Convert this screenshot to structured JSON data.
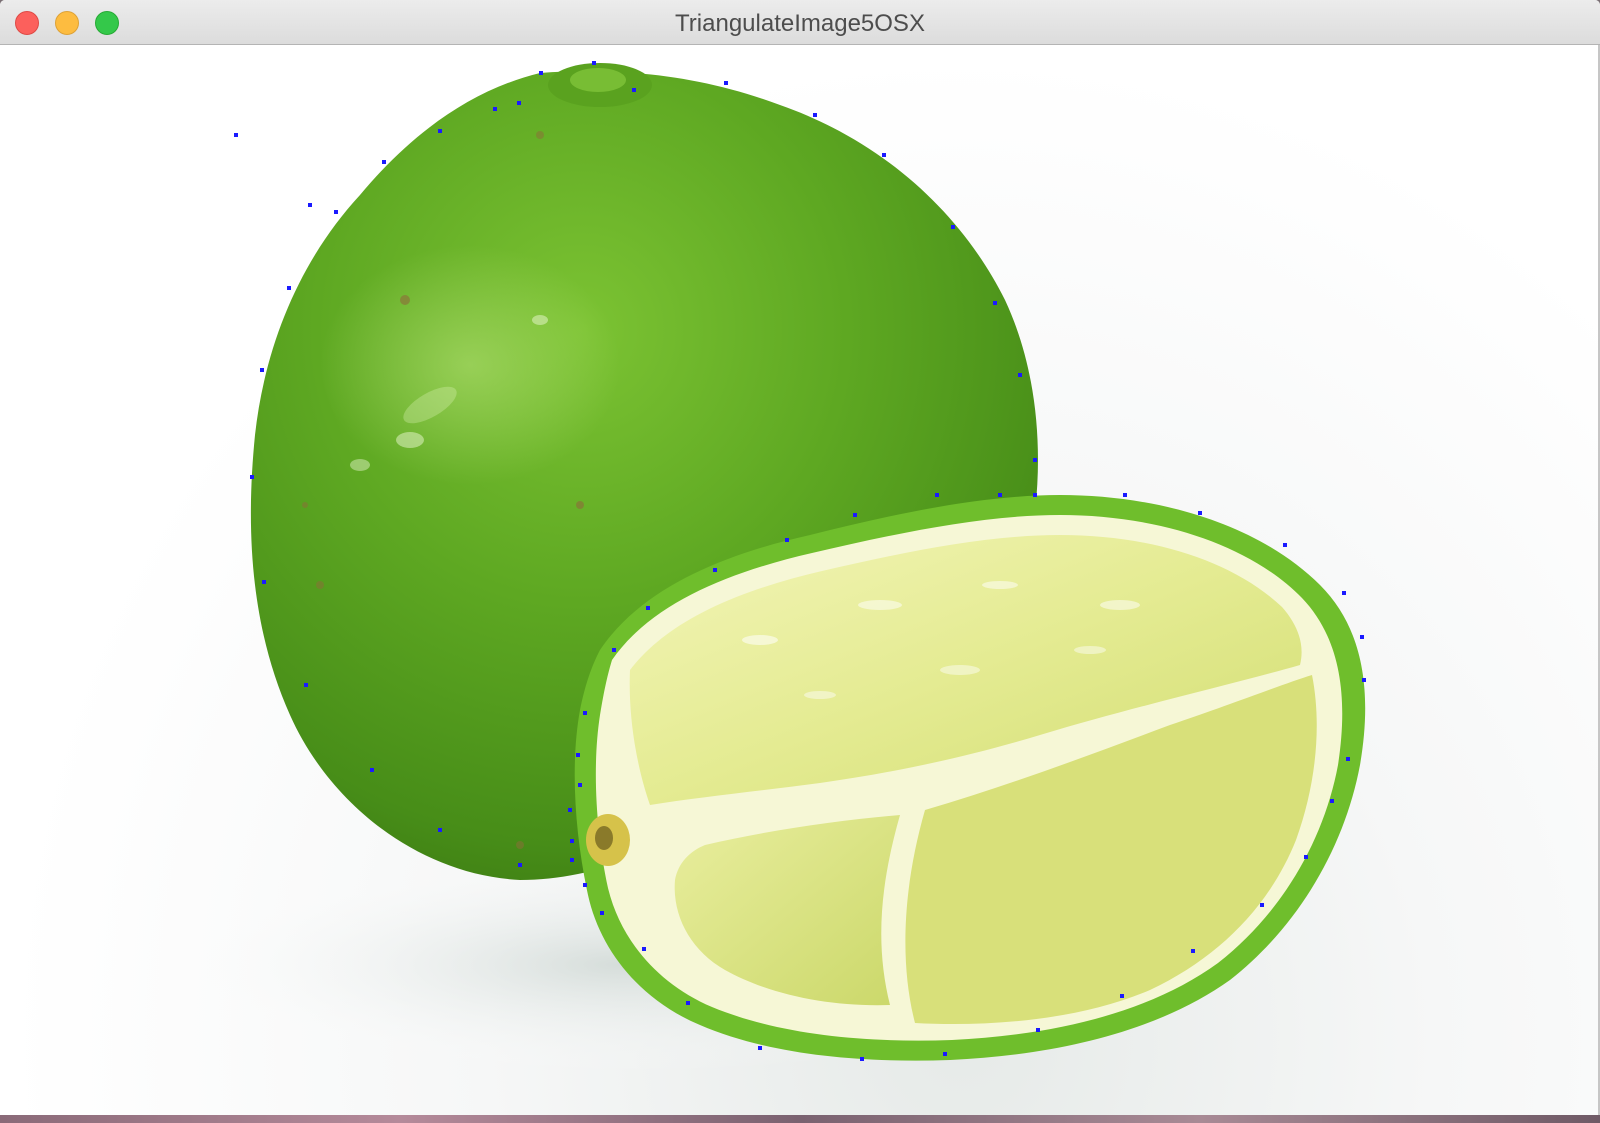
{
  "window": {
    "title": "TriangulateImage5OSX"
  },
  "controls": {
    "close": "close-button",
    "minimize": "minimize-button",
    "zoom": "zoom-button"
  },
  "colors": {
    "lime_dark": "#4f9a1c",
    "lime_mid": "#6cb52a",
    "lime_light": "#8fce3e",
    "pulp": "#e9ef9a",
    "pulp_dark": "#cfdc6b",
    "pith": "#fbfbe6",
    "point": "#1a1aff"
  },
  "image": {
    "subject": "lime",
    "point_marker_color": "#1a1aff"
  }
}
